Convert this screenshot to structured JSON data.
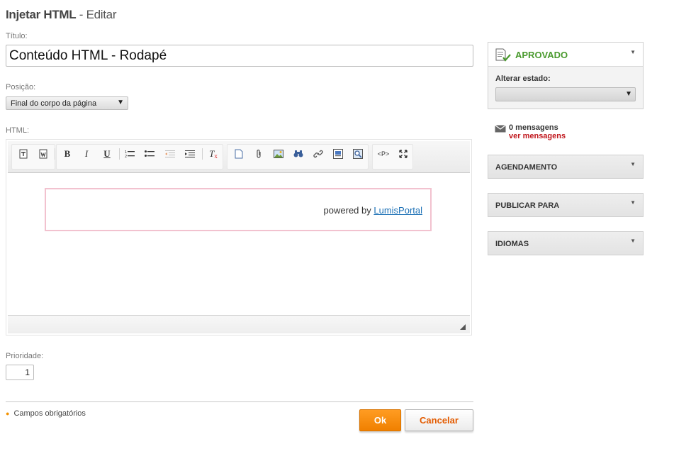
{
  "header": {
    "title_strong": "Injetar HTML",
    "title_suffix": " - Editar"
  },
  "form": {
    "titulo_label": "Título:",
    "titulo_value": "Conteúdo HTML - Rodapé",
    "posicao_label": "Posição:",
    "posicao_value": "Final do corpo da página",
    "html_label": "HTML:",
    "prioridade_label": "Prioridade:",
    "prioridade_value": "1",
    "required_note": "Campos obrigatórios",
    "ok_label": "Ok",
    "cancel_label": "Cancelar"
  },
  "editor": {
    "content_text": "powered by ",
    "content_link": "LumisPortal",
    "toolbar_icons": [
      "template-icon",
      "paste-word-icon",
      "bold-icon",
      "italic-icon",
      "underline-icon",
      "numbered-list-icon",
      "bulleted-list-icon",
      "outdent-icon",
      "indent-icon",
      "remove-format-icon",
      "new-page-icon",
      "attach-icon",
      "image-icon",
      "find-icon",
      "link-icon",
      "anchor-icon",
      "preview-icon",
      "source-icon",
      "maximize-icon"
    ]
  },
  "sidebar": {
    "status": "APROVADO",
    "status_color": "#4a9a2e",
    "alter_label": "Alterar estado:",
    "messages_count": "0 mensagens",
    "messages_link": "ver mensagens",
    "panels": [
      "AGENDAMENTO",
      "PUBLICAR PARA",
      "IDIOMAS"
    ]
  },
  "colors": {
    "accent": "#f08000",
    "link": "#1a6fb5",
    "alert": "#c0151b"
  }
}
